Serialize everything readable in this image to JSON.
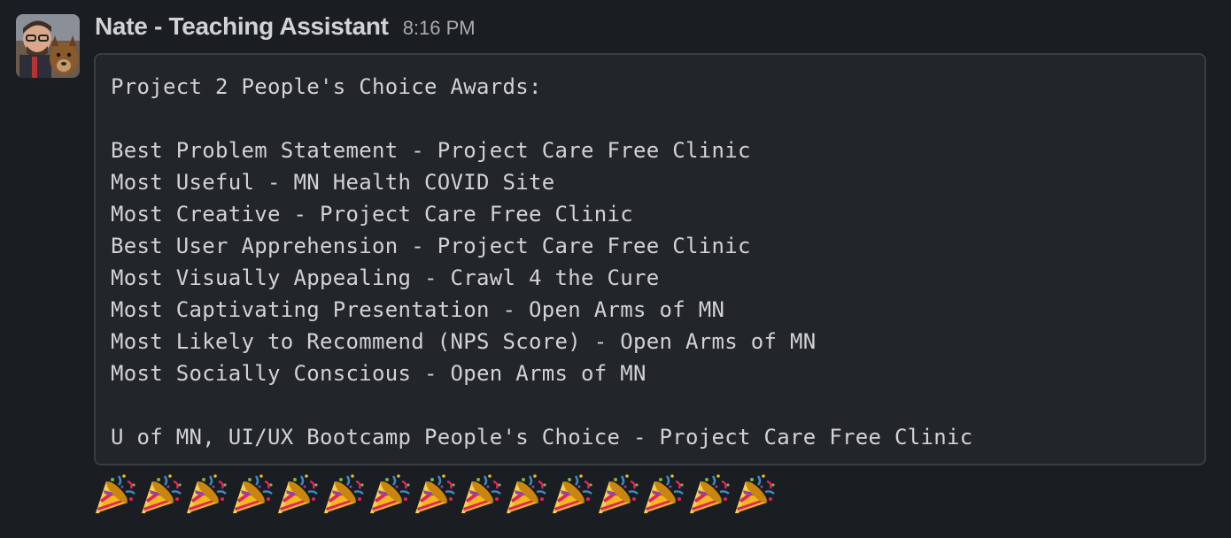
{
  "message": {
    "author": "Nate - Teaching Assistant",
    "timestamp": "8:16 PM",
    "code_lines": [
      "Project 2 People's Choice Awards:",
      "",
      "Best Problem Statement - Project Care Free Clinic",
      "Most Useful - MN Health COVID Site",
      "Most Creative - Project Care Free Clinic",
      "Best User Apprehension - Project Care Free Clinic",
      "Most Visually Appealing - Crawl 4 the Cure",
      "Most Captivating Presentation - Open Arms of MN",
      "Most Likely to Recommend (NPS Score) - Open Arms of MN",
      "Most Socially Conscious - Open Arms of MN",
      "",
      "U of MN, UI/UX Bootcamp People's Choice - Project Care Free Clinic"
    ],
    "reactions": {
      "emoji": "party-popper",
      "count_shown": 15
    }
  },
  "colors": {
    "background": "#1a1d21",
    "code_background": "#222529",
    "code_border": "#3a3d42",
    "text": "#d1d2d3",
    "timestamp": "#ababad"
  }
}
